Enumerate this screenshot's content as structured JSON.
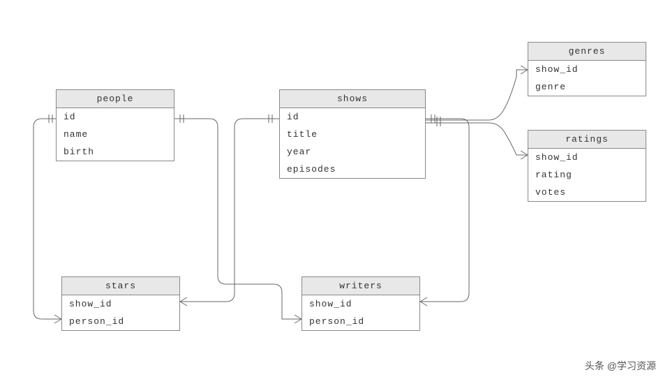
{
  "entities": {
    "people": {
      "title": "people",
      "fields": [
        "id",
        "name",
        "birth"
      ]
    },
    "shows": {
      "title": "shows",
      "fields": [
        "id",
        "title",
        "year",
        "episodes"
      ]
    },
    "genres": {
      "title": "genres",
      "fields": [
        "show_id",
        "genre"
      ]
    },
    "ratings": {
      "title": "ratings",
      "fields": [
        "show_id",
        "rating",
        "votes"
      ]
    },
    "stars": {
      "title": "stars",
      "fields": [
        "show_id",
        "person_id"
      ]
    },
    "writers": {
      "title": "writers",
      "fields": [
        "show_id",
        "person_id"
      ]
    }
  },
  "relationships": [
    {
      "from": "people",
      "to": "stars",
      "via": "person_id"
    },
    {
      "from": "people",
      "to": "writers",
      "via": "person_id"
    },
    {
      "from": "shows",
      "to": "stars",
      "via": "show_id"
    },
    {
      "from": "shows",
      "to": "writers",
      "via": "show_id"
    },
    {
      "from": "shows",
      "to": "genres",
      "via": "show_id"
    },
    {
      "from": "shows",
      "to": "ratings",
      "via": "show_id"
    }
  ],
  "watermark": "头条 @学习资源"
}
